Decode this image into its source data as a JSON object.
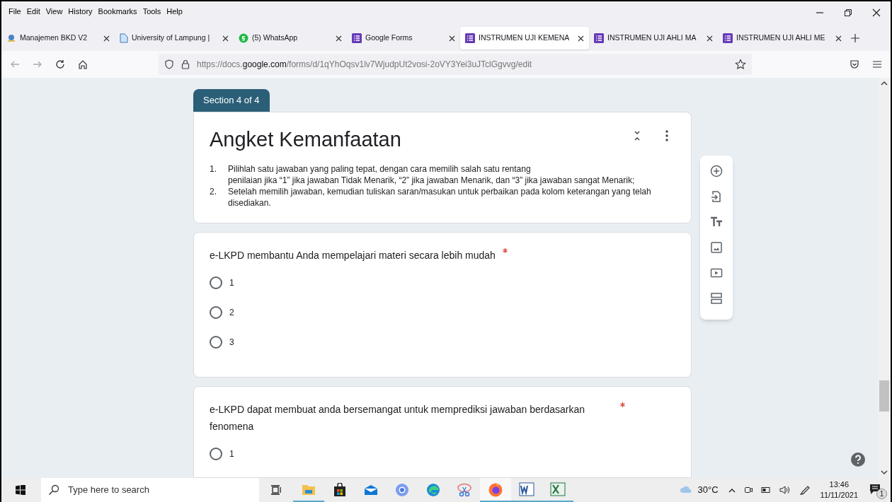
{
  "menu_bar": [
    "File",
    "Edit",
    "View",
    "History",
    "Bookmarks",
    "Tools",
    "Help"
  ],
  "tabs": [
    {
      "label": "Manajemen BKD V2",
      "kind": "site",
      "selected": false
    },
    {
      "label": "University of Lampung |",
      "kind": "doc",
      "selected": false
    },
    {
      "label": "(5) WhatsApp",
      "kind": "whatsapp",
      "selected": false
    },
    {
      "label": "Google Forms",
      "kind": "forms",
      "selected": false
    },
    {
      "label": "INSTRUMEN UJI KEMENA",
      "kind": "forms",
      "selected": true
    },
    {
      "label": "INSTRUMEN UJI AHLI MA",
      "kind": "forms",
      "selected": false
    },
    {
      "label": "INSTRUMEN UJI AHLI ME",
      "kind": "forms",
      "selected": false
    }
  ],
  "address_bar": {
    "prefix": "https://docs.",
    "domain": "google.com",
    "path": "/forms/d/1qYhOqsv1lv7WjudpUt2vosi-2oVY3Yei3uJTclGgvvg/edit"
  },
  "section_badge": "Section 4 of 4",
  "header": {
    "title": "Angket Kemanfaatan",
    "instructions": [
      {
        "number": "1.",
        "lines": [
          "Pilihlah satu jawaban yang paling tepat, dengan cara memilih salah satu rentang",
          "penilaian jika “1” jika jawaban Tidak Menarik, “2” jika jawaban Menarik, dan “3” jika jawaban sangat Menarik;"
        ]
      },
      {
        "number": "2.",
        "lines": [
          "Setelah memilih jawaban, kemudian tuliskan saran/masukan untuk perbaikan pada kolom keterangan yang telah disediakan."
        ]
      }
    ]
  },
  "questions": [
    {
      "title": "e-LKPD membantu Anda mempelajari materi secara lebih mudah",
      "required": true,
      "options": [
        {
          "label": "1",
          "selected": false
        },
        {
          "label": "2",
          "selected": false
        },
        {
          "label": "3",
          "selected": false
        }
      ]
    },
    {
      "title": "e-LKPD dapat membuat anda bersemangat untuk memprediksi jawaban berdasarkan fenomena",
      "required": true,
      "options": [
        {
          "label": "1",
          "selected": false
        }
      ]
    }
  ],
  "taskbar": {
    "search_placeholder": "Type here to search",
    "temperature": "30°C",
    "time": "13:46",
    "date": "11/11/2021",
    "notifications": "1"
  }
}
